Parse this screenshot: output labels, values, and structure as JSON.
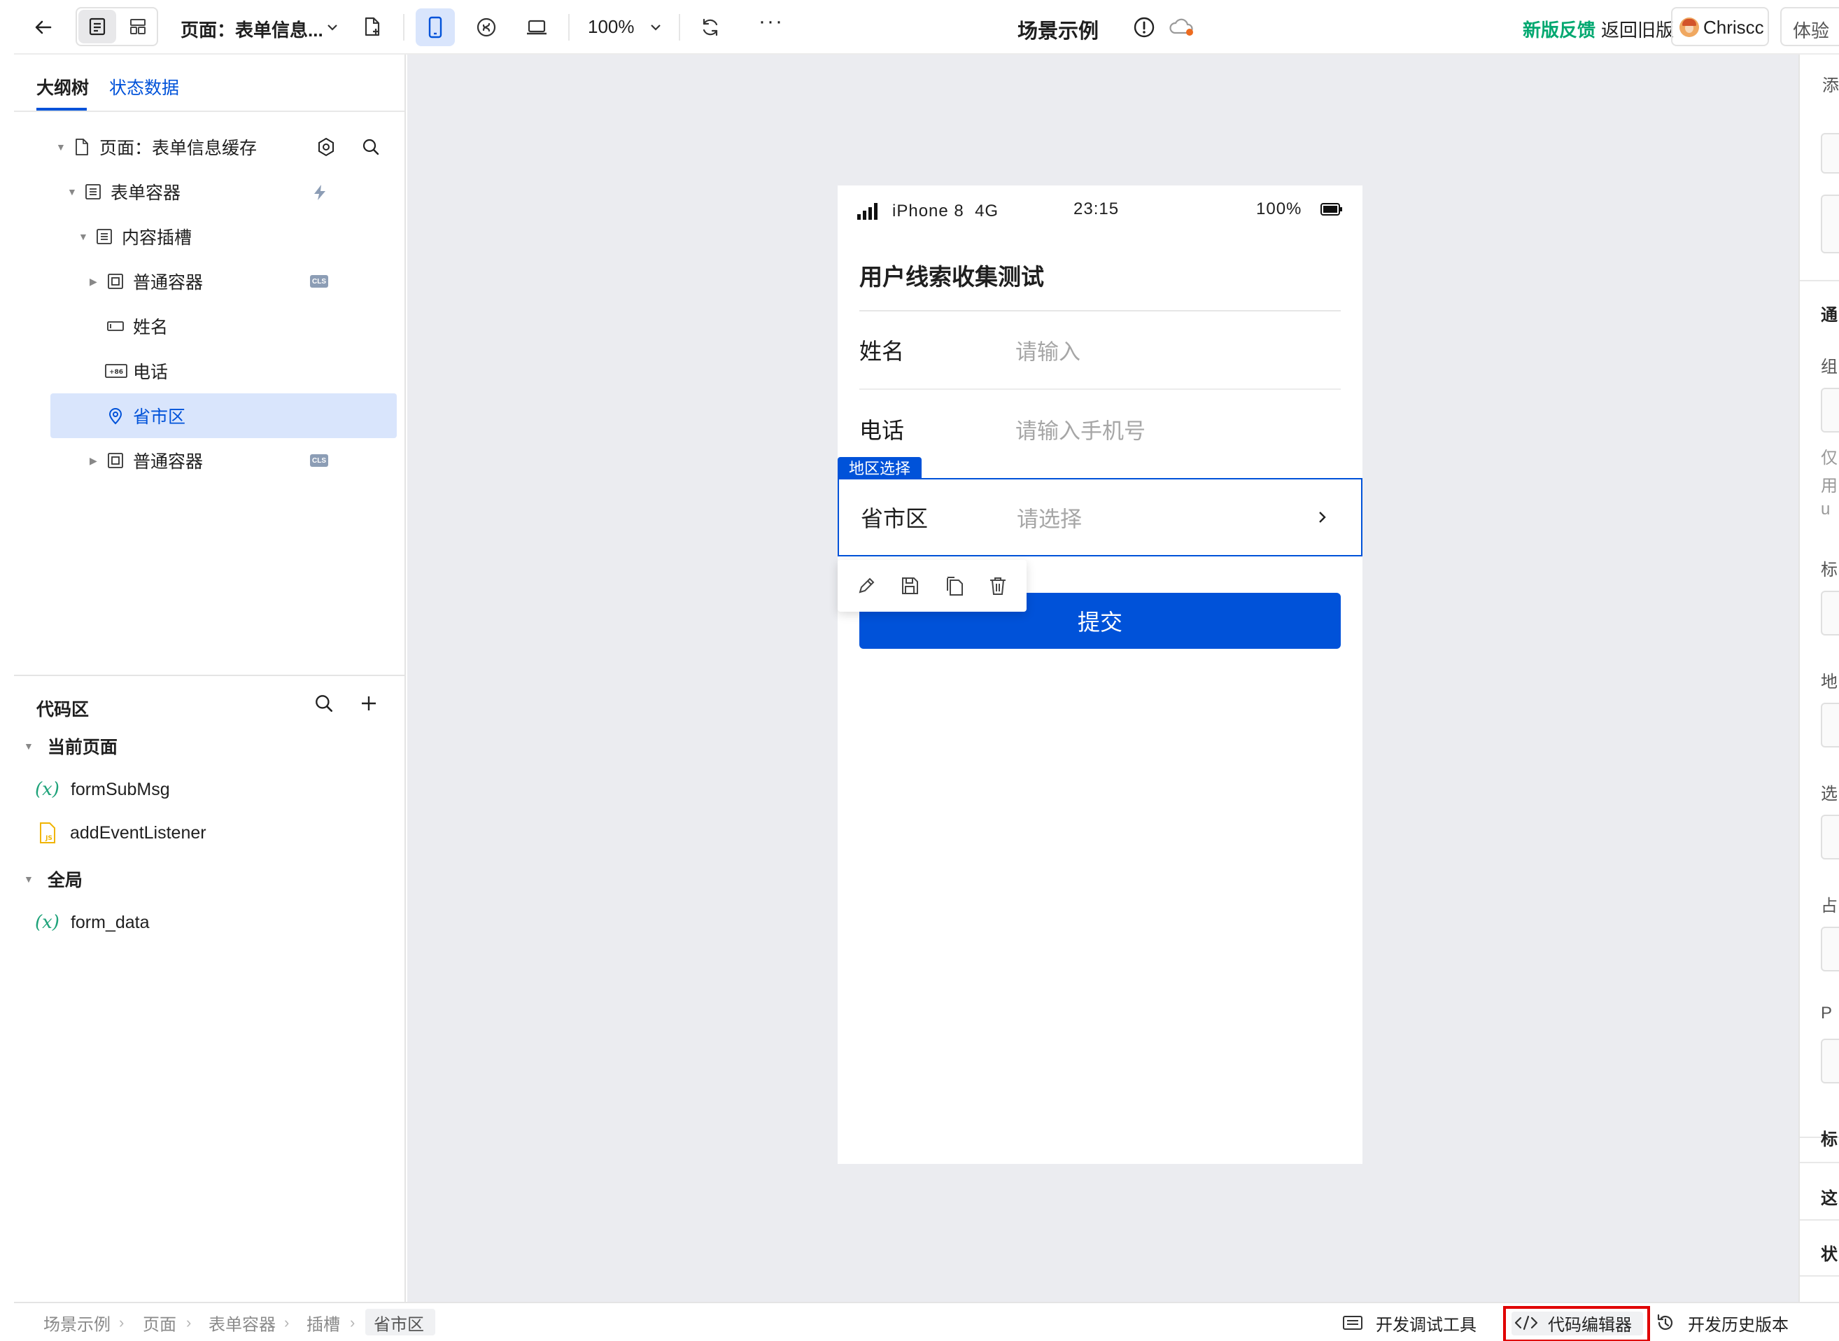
{
  "header": {
    "page_selector_label": "页面：表单信息...",
    "zoom_label": "100%",
    "more_label": "···",
    "app_title": "场景示例",
    "feedback_label": "新版反馈",
    "old_version_label": "返回旧版",
    "user_name": "Chriscc",
    "experience_label": "体验"
  },
  "left_panel": {
    "tabs": [
      "大纲树",
      "状态数据"
    ],
    "active_tab": 0,
    "outline": [
      {
        "label": "页面：表单信息缓存",
        "icon": "page-icon",
        "depth": 0,
        "expanded": true
      },
      {
        "label": "表单容器",
        "icon": "form-icon",
        "depth": 1,
        "expanded": true
      },
      {
        "label": "内容插槽",
        "icon": "slot-icon",
        "depth": 2,
        "expanded": true
      },
      {
        "label": "普通容器",
        "icon": "container-icon",
        "depth": 3,
        "expanded": false,
        "badge": "CLS"
      },
      {
        "label": "姓名",
        "icon": "input-icon",
        "depth": 3
      },
      {
        "label": "电话",
        "icon": "phone-input-icon",
        "depth": 3
      },
      {
        "label": "省市区",
        "icon": "location-icon",
        "depth": 3,
        "selected": true
      },
      {
        "label": "普通容器",
        "icon": "container-icon",
        "depth": 3,
        "expanded": false,
        "badge": "CLS"
      }
    ],
    "code_area": {
      "title": "代码区",
      "groups": [
        {
          "label": "当前页面",
          "items": [
            {
              "label": "formSubMsg",
              "icon": "variable-icon"
            },
            {
              "label": "addEventListener",
              "icon": "js-file-icon"
            }
          ]
        },
        {
          "label": "全局",
          "items": [
            {
              "label": "form_data",
              "icon": "variable-icon"
            }
          ]
        }
      ]
    }
  },
  "phone": {
    "status_bar": {
      "carrier": "iPhone 8  4G",
      "time": "23:15",
      "battery": "100%"
    },
    "form_title": "用户线索收集测试",
    "fields": [
      {
        "label": "姓名",
        "placeholder": "请输入"
      },
      {
        "label": "电话",
        "placeholder": "请输入手机号"
      },
      {
        "label": "省市区",
        "placeholder": "请选择",
        "has_chevron": true,
        "tag": "地区选择",
        "selected": true
      }
    ],
    "submit_label": "提交"
  },
  "bottom_bar": {
    "breadcrumb": [
      "场景示例",
      "页面",
      "表单容器",
      "插槽",
      "省市区"
    ],
    "tools": [
      {
        "label": "开发调试工具",
        "icon": "debug-icon"
      },
      {
        "label": "代码编辑器",
        "icon": "code-icon",
        "highlighted": true
      },
      {
        "label": "开发历史版本",
        "icon": "history-icon"
      }
    ]
  },
  "right_panel": {
    "visible_fragments": [
      "添",
      "通",
      "组",
      "仅",
      "用",
      "u",
      "标",
      "地",
      "选",
      "占",
      "P",
      "标",
      "这",
      "状"
    ]
  },
  "colors": {
    "accent": "#0052d9",
    "selection_bg": "#d9e5fc",
    "feedback_green": "#00a870",
    "highlight_red": "#e00000",
    "canvas_bg": "#ebecf0"
  }
}
